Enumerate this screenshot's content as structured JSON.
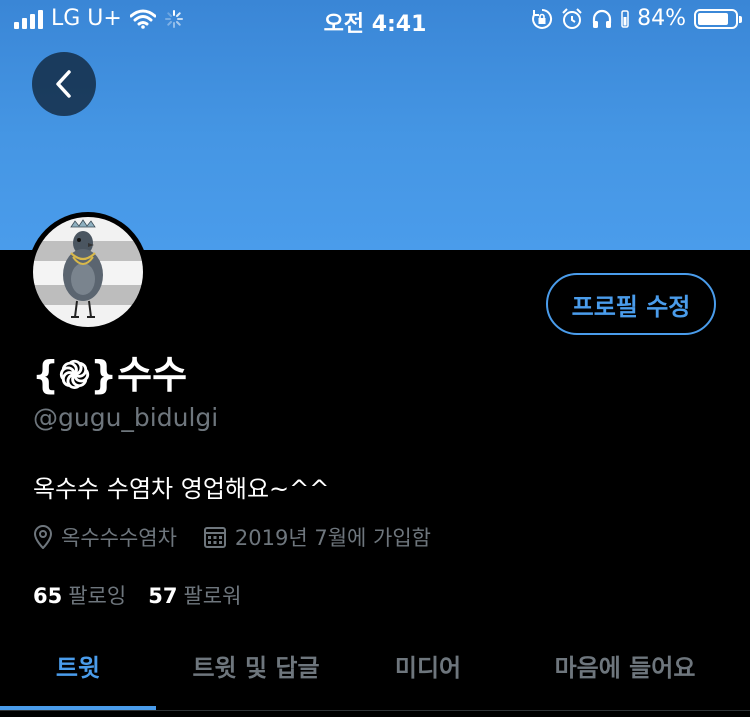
{
  "status_bar": {
    "carrier": "LG U+",
    "time": "오전 4:41",
    "battery_percent": "84%",
    "battery_level": 0.84
  },
  "header": {
    "back_icon": "chevron-left-icon",
    "banner_color": "#4596e4"
  },
  "profile": {
    "display_name": "{֎}수수",
    "handle": "@gugu_bidulgi",
    "bio": "옥수수 수염차 영업해요~^^",
    "location": "옥수수수염차",
    "joined": "2019년 7월에 가입함",
    "edit_button": "프로필 수정",
    "following_count": "65",
    "following_label": "팔로잉",
    "followers_count": "57",
    "followers_label": "팔로워"
  },
  "tabs": [
    {
      "label": "트윗",
      "active": true
    },
    {
      "label": "트윗 및 답글",
      "active": false
    },
    {
      "label": "미디어",
      "active": false
    },
    {
      "label": "마음에 들어요",
      "active": false
    }
  ],
  "colors": {
    "accent": "#4a9ceb",
    "muted": "#6e767d",
    "background": "#000000"
  }
}
